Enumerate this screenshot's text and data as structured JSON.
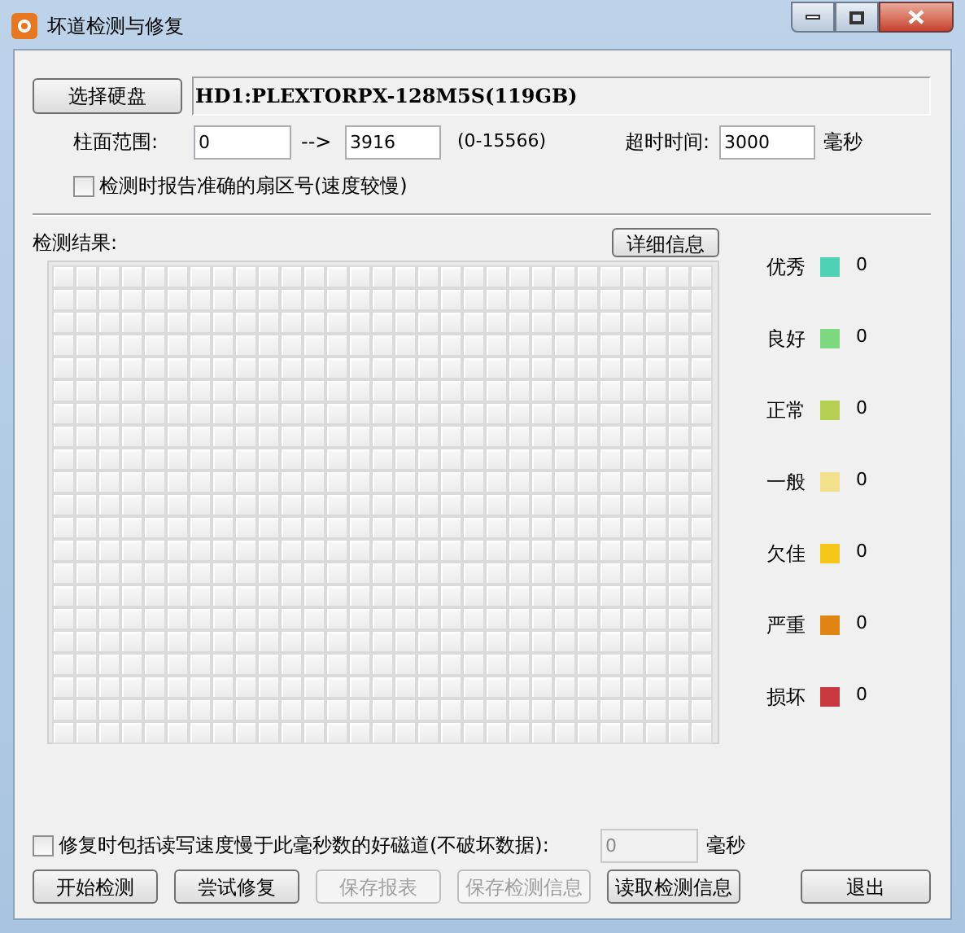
{
  "window": {
    "title": "坏道检测与修复"
  },
  "disk": {
    "button": "选择硬盘",
    "value": "HD1:PLEXTORPX-128M5S(119GB)"
  },
  "range": {
    "label": "柱面范围:",
    "from": "0",
    "arrow": "-->",
    "to": "3916",
    "hint": "(0-15566)"
  },
  "timeout": {
    "label": "超时时间:",
    "value": "3000",
    "unit": "毫秒"
  },
  "accurate_sector": {
    "label": "检测时报告准确的扇区号(速度较慢)",
    "checked": false
  },
  "results": {
    "label": "检测结果:",
    "detail_button": "详细信息"
  },
  "legend": [
    {
      "name": "优秀",
      "color": "#4fd1b5",
      "count": "0"
    },
    {
      "name": "良好",
      "color": "#7dd87f",
      "count": "0"
    },
    {
      "name": "正常",
      "color": "#b5cf52",
      "count": "0"
    },
    {
      "name": "一般",
      "color": "#f3e08c",
      "count": "0"
    },
    {
      "name": "欠佳",
      "color": "#f5c71a",
      "count": "0"
    },
    {
      "name": "严重",
      "color": "#e08413",
      "count": "0"
    },
    {
      "name": "损坏",
      "color": "#c9383e",
      "count": "0"
    }
  ],
  "repair_slow": {
    "label": "修复时包括读写速度慢于此毫秒数的好磁道(不破坏数据):",
    "checked": false,
    "value": "0",
    "unit": "毫秒",
    "disabled": true
  },
  "buttons": [
    {
      "label": "开始检测",
      "disabled": false
    },
    {
      "label": "尝试修复",
      "disabled": false
    },
    {
      "label": "保存报表",
      "disabled": true
    },
    {
      "label": "保存检测信息",
      "disabled": true
    },
    {
      "label": "读取检测信息",
      "disabled": false
    },
    {
      "label": "退出",
      "disabled": false
    }
  ]
}
